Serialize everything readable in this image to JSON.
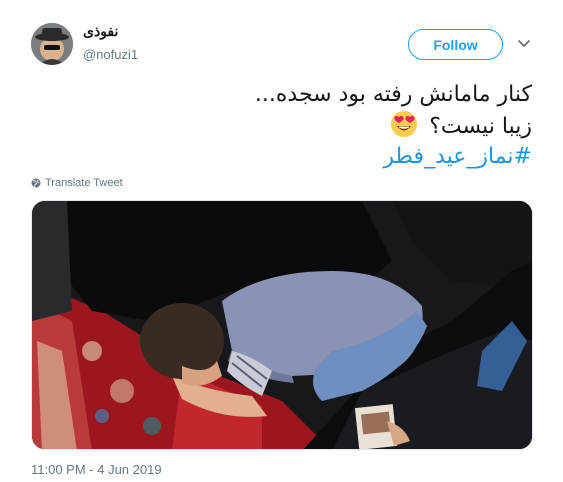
{
  "user": {
    "display_name": "نفوذی",
    "screen_name": "@nofuzi1",
    "avatar_icon": "spy-avatar-icon"
  },
  "header": {
    "follow_label": "Follow",
    "more_icon": "chevron-down-icon"
  },
  "tweet": {
    "line1": "کنار مامانش رفته بود سجده...",
    "line2": "زیبا نیست؟",
    "emoji": "smiling-face-with-heart-eyes-icon",
    "hashtag": "#نماز_عید_فطر"
  },
  "translate": {
    "label": "Translate Tweet",
    "icon": "globe-icon"
  },
  "media": {
    "image_icon": "photo-child-praying-icon"
  },
  "timestamp": "11:00 PM - 4 Jun 2019",
  "colors": {
    "link": "#1b95e0",
    "follow": "#1da1f2",
    "secondary_text": "#657786"
  }
}
